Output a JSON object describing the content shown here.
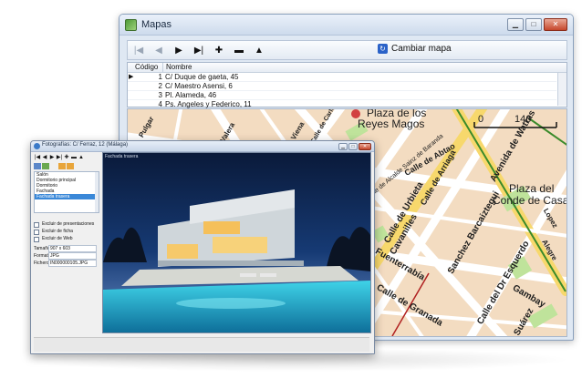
{
  "back_window": {
    "title": "Mapas",
    "controls": {
      "minimize": "▁",
      "maximize": "□",
      "close": "✕"
    },
    "nav": {
      "first": "|◀",
      "prev": "◀",
      "next": "▶",
      "last": "▶|",
      "add": "✚",
      "delete": "▬",
      "up": "▲",
      "change_map_label": "Cambiar mapa"
    },
    "grid": {
      "columns": [
        "Código",
        "Nombre"
      ],
      "rows": [
        {
          "codigo": "1",
          "nombre": "C/ Duque de gaeta, 45"
        },
        {
          "codigo": "2",
          "nombre": "C/ Maestro Asensi, 6"
        },
        {
          "codigo": "3",
          "nombre": "Pl. Alameda, 46"
        },
        {
          "codigo": "4",
          "nombre": "Ps. Angeles y Federico, 11"
        }
      ]
    },
    "map": {
      "scale_label": "146",
      "scale_zero": "0",
      "streets": [
        "Plaza de los",
        "Reyes Magos",
        "Plaza del",
        "Conde de Casal",
        "Calle de Alcalde Sainz de Baranda",
        "Calle de Arriaga",
        "Calle de Urbieta",
        "Cavanilles",
        "Sanchez Barcaiztegui",
        "Calle del Dr Esquerdo",
        "Gambay",
        "Suárez",
        "Calle de Granada",
        "Fuenterrabía",
        "Juan Valera",
        "Plaza de Viena",
        "Pulgar",
        "Calle de Carlos",
        "Calle de Abtao",
        "Avenida de Watras",
        "Alegre",
        "Lopez"
      ]
    }
  },
  "front_window": {
    "title": "Fotografías: C/ Ferraz, 12 (Málaga)",
    "controls": {
      "minimize": "▁",
      "maximize": "□",
      "close": "✕"
    },
    "nav": {
      "first": "|◀",
      "prev": "◀",
      "next": "▶",
      "last": "▶|",
      "add": "✚",
      "delete": "▬",
      "up": "▲"
    },
    "rooms": [
      "Salón",
      "Dormitorio principal",
      "Dormitorio",
      "Fachada",
      "Fachada trasera"
    ],
    "selected_room": "Fachada trasera",
    "checks": [
      "Excluir de presentaciones",
      "Excluir de ficha",
      "Excluir de Web"
    ],
    "props": [
      {
        "label": "Tamaño",
        "value": "907 x 603"
      },
      {
        "label": "Formato",
        "value": "JPG"
      },
      {
        "label": "Fichero",
        "value": "IN000000105.JPG"
      }
    ],
    "photo_caption": "Fachada trasera"
  }
}
